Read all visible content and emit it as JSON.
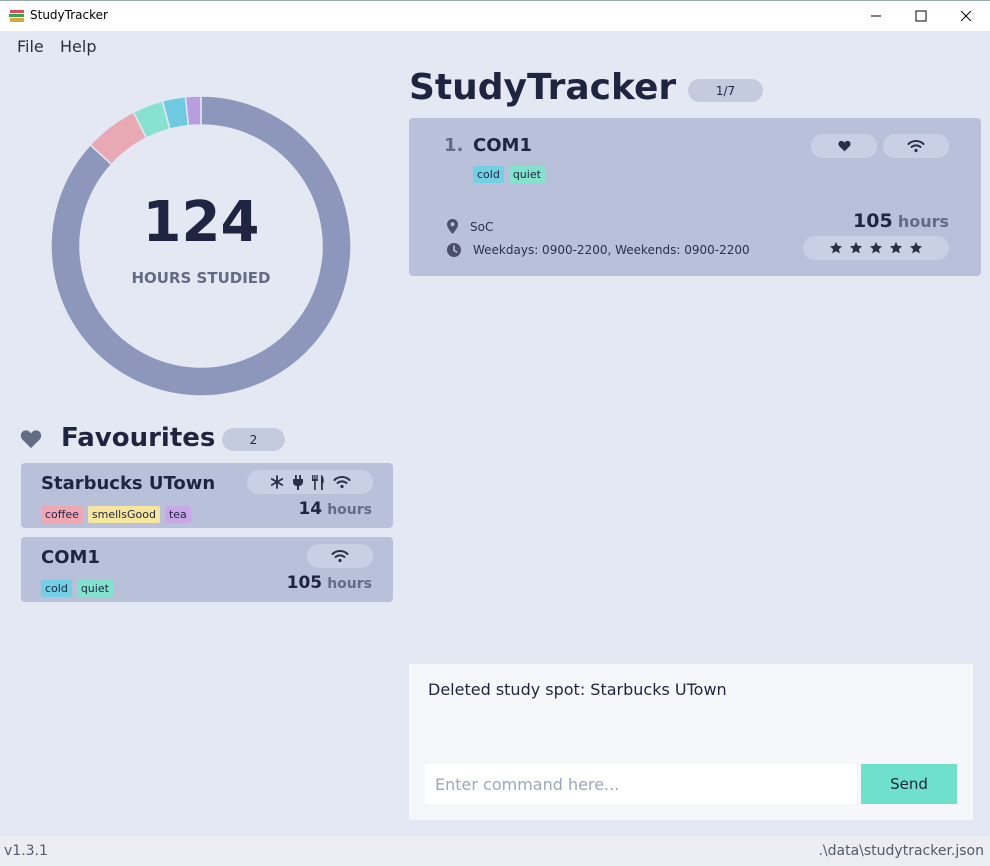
{
  "window": {
    "title": "StudyTracker",
    "controls": {
      "minimize": "—",
      "maximize": "☐",
      "close": "✕"
    }
  },
  "menu": {
    "items": [
      "File",
      "Help"
    ]
  },
  "stats": {
    "total_hours": "124",
    "label": "HOURS STUDIED",
    "segments": [
      {
        "name": "COM1",
        "hours": 105,
        "color": "#8c97bb"
      },
      {
        "name": "pink",
        "hours": 7,
        "color": "#e8a8b4"
      },
      {
        "name": "teal",
        "hours": 4,
        "color": "#87e2cf"
      },
      {
        "name": "blue",
        "hours": 3,
        "color": "#6fc9e0"
      },
      {
        "name": "purple",
        "hours": 2,
        "color": "#b89ee0"
      }
    ]
  },
  "favourites": {
    "title": "Favourites",
    "count": "2",
    "cards": [
      {
        "name": "Starbucks UTown",
        "tags": [
          {
            "label": "coffee",
            "color": "#f0a6b3"
          },
          {
            "label": "smellsGood",
            "color": "#f7e69d"
          },
          {
            "label": "tea",
            "color": "#c9a7e6"
          }
        ],
        "amenities": [
          "snowflake-icon",
          "plug-icon",
          "utensils-icon",
          "wifi-icon"
        ],
        "hours": "14",
        "hours_unit": "hours"
      },
      {
        "name": "COM1",
        "tags": [
          {
            "label": "cold",
            "color": "#72cfe4"
          },
          {
            "label": "quiet",
            "color": "#83e2cd"
          }
        ],
        "amenities": [
          "wifi-icon"
        ],
        "hours": "105",
        "hours_unit": "hours"
      }
    ]
  },
  "main": {
    "title": "StudyTracker",
    "page_indicator": "1/7",
    "spot": {
      "index": "1.",
      "name": "COM1",
      "tags": [
        {
          "label": "cold",
          "color": "#72cfe4"
        },
        {
          "label": "quiet",
          "color": "#83e2cd"
        }
      ],
      "location": "SoC",
      "hours_text": "Weekdays: 0900-2200, Weekends: 0900-2200",
      "hours": "105",
      "hours_unit": "hours",
      "rating": 5,
      "rating_max": 5
    }
  },
  "result": {
    "text": "Deleted study spot: Starbucks UTown"
  },
  "command": {
    "placeholder": "Enter command here...",
    "value": "",
    "send_label": "Send"
  },
  "status": {
    "version": "v1.3.1",
    "path": ".\\data\\studytracker.json"
  }
}
